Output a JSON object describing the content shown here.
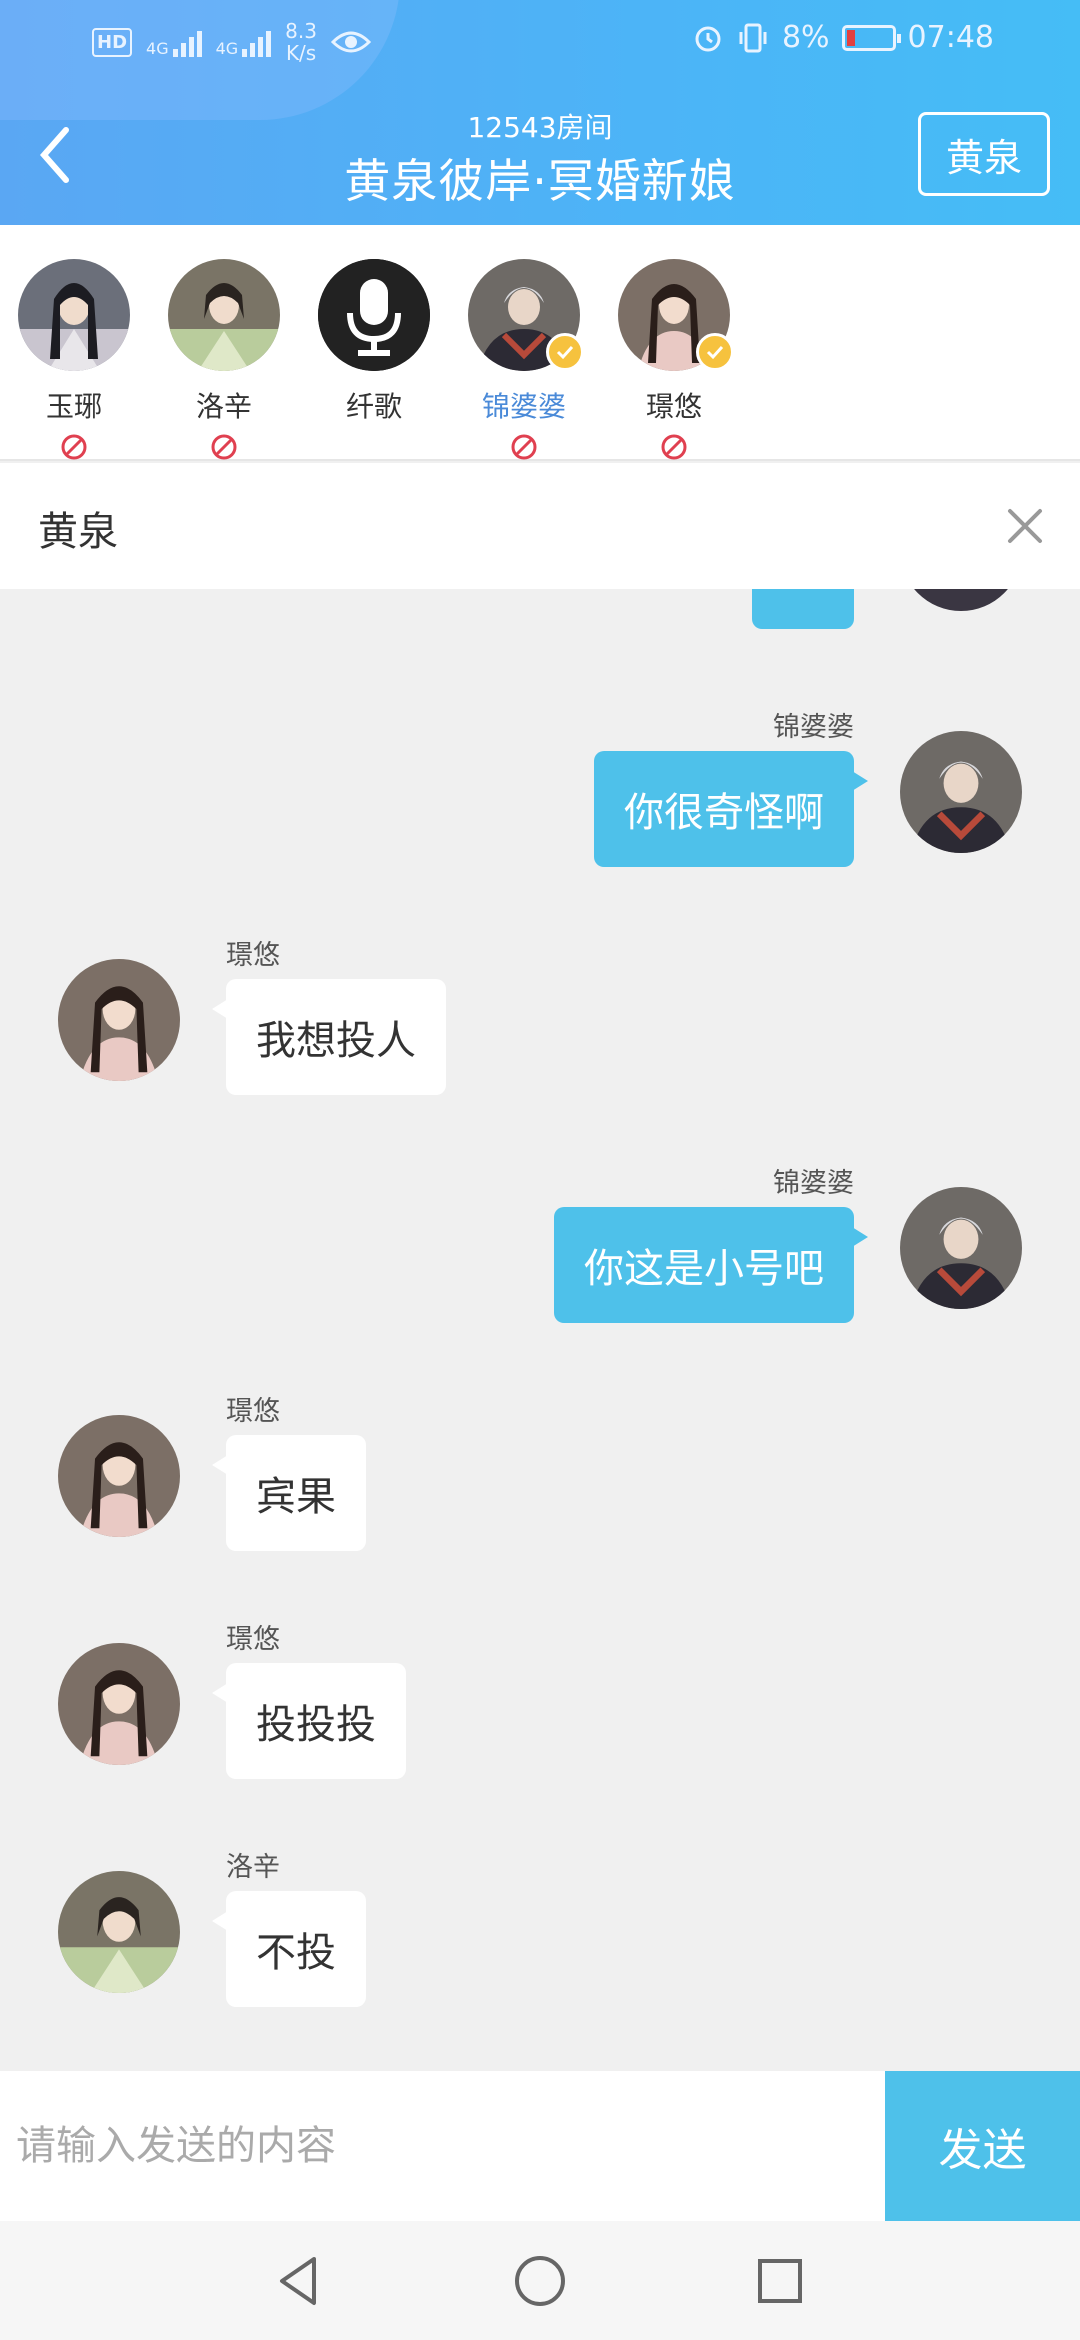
{
  "status_bar": {
    "speed_value": "8.3",
    "speed_unit": "K/s",
    "battery": "8%",
    "time": "07:48",
    "net1": "4G",
    "net2": "4G",
    "hd": "HD"
  },
  "header": {
    "room_number": "12543房间",
    "title": "黄泉彼岸·冥婚新娘",
    "right_button": "黄泉"
  },
  "members": [
    {
      "name": "玉琊",
      "muted": true,
      "verified": false,
      "mic": false,
      "active": false
    },
    {
      "name": "洛辛",
      "muted": true,
      "verified": false,
      "mic": false,
      "active": false
    },
    {
      "name": "纤歌",
      "muted": false,
      "verified": false,
      "mic": true,
      "active": false
    },
    {
      "name": "锦婆婆",
      "muted": true,
      "verified": true,
      "mic": false,
      "active": true
    },
    {
      "name": "璟悠",
      "muted": true,
      "verified": true,
      "mic": false,
      "active": false
    }
  ],
  "filter": {
    "label": "黄泉"
  },
  "messages": [
    {
      "side": "right",
      "sender": "锦婆婆",
      "text": "你很奇怪啊"
    },
    {
      "side": "left",
      "sender": "璟悠",
      "text": "我想投人"
    },
    {
      "side": "right",
      "sender": "锦婆婆",
      "text": "你这是小号吧"
    },
    {
      "side": "left",
      "sender": "璟悠",
      "text": "宾果"
    },
    {
      "side": "left",
      "sender": "璟悠",
      "text": "投投投"
    },
    {
      "side": "left",
      "sender": "洛辛",
      "text": "不投"
    }
  ],
  "input": {
    "placeholder": "请输入发送的内容",
    "value": "",
    "send_label": "发送"
  },
  "colors": {
    "header_start": "#5aa7f3",
    "header_end": "#45bdf6",
    "bubble_right": "#4ec1ea",
    "send_button": "#4ec1ea",
    "active_name": "#4a8ad8",
    "ban_red": "#e04050",
    "check_yellow": "#f6c23e"
  }
}
